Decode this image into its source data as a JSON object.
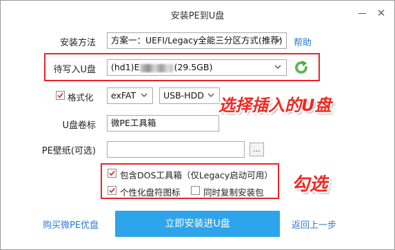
{
  "window": {
    "title": "安装PE到U盘",
    "minimize_label": "—",
    "close_label": "✕"
  },
  "install_method": {
    "label": "安装方法",
    "value": "方案一：UEFI/Legacy全能三分区方式(推荐)",
    "help_link": "帮助"
  },
  "target_disk": {
    "label": "待写入U盘",
    "value_prefix": "(hd1)E",
    "value_suffix": "(29.5GB)",
    "refresh_icon": "refresh-icon"
  },
  "format": {
    "label": "格式化",
    "checked": true,
    "fs_value": "exFAT",
    "mode_value": "USB-HDD"
  },
  "volume_label": {
    "label": "U盘卷标",
    "value": "微PE工具箱"
  },
  "wallpaper": {
    "label": "PE壁纸(可选)",
    "value": "",
    "browse_label": "..."
  },
  "options": {
    "include_dos": {
      "label": "包含DOS工具箱（仅Legacy启动可用）",
      "checked": true
    },
    "custom_icon": {
      "label": "个性化盘符图标",
      "checked": true
    },
    "copy_package": {
      "label": "同时复制安装包",
      "checked": false
    }
  },
  "annotations": {
    "select_usb": "选择插入的U盘",
    "check": "勾选"
  },
  "footer": {
    "buy_link": "购买微PE优盘",
    "install_button": "立即安装进U盘",
    "back_link": "返回上一步"
  },
  "colors": {
    "accent": "#2ea5ea",
    "link": "#2a7ad6",
    "annotation_red": "#e8242a",
    "refresh_green": "#3aa832"
  }
}
